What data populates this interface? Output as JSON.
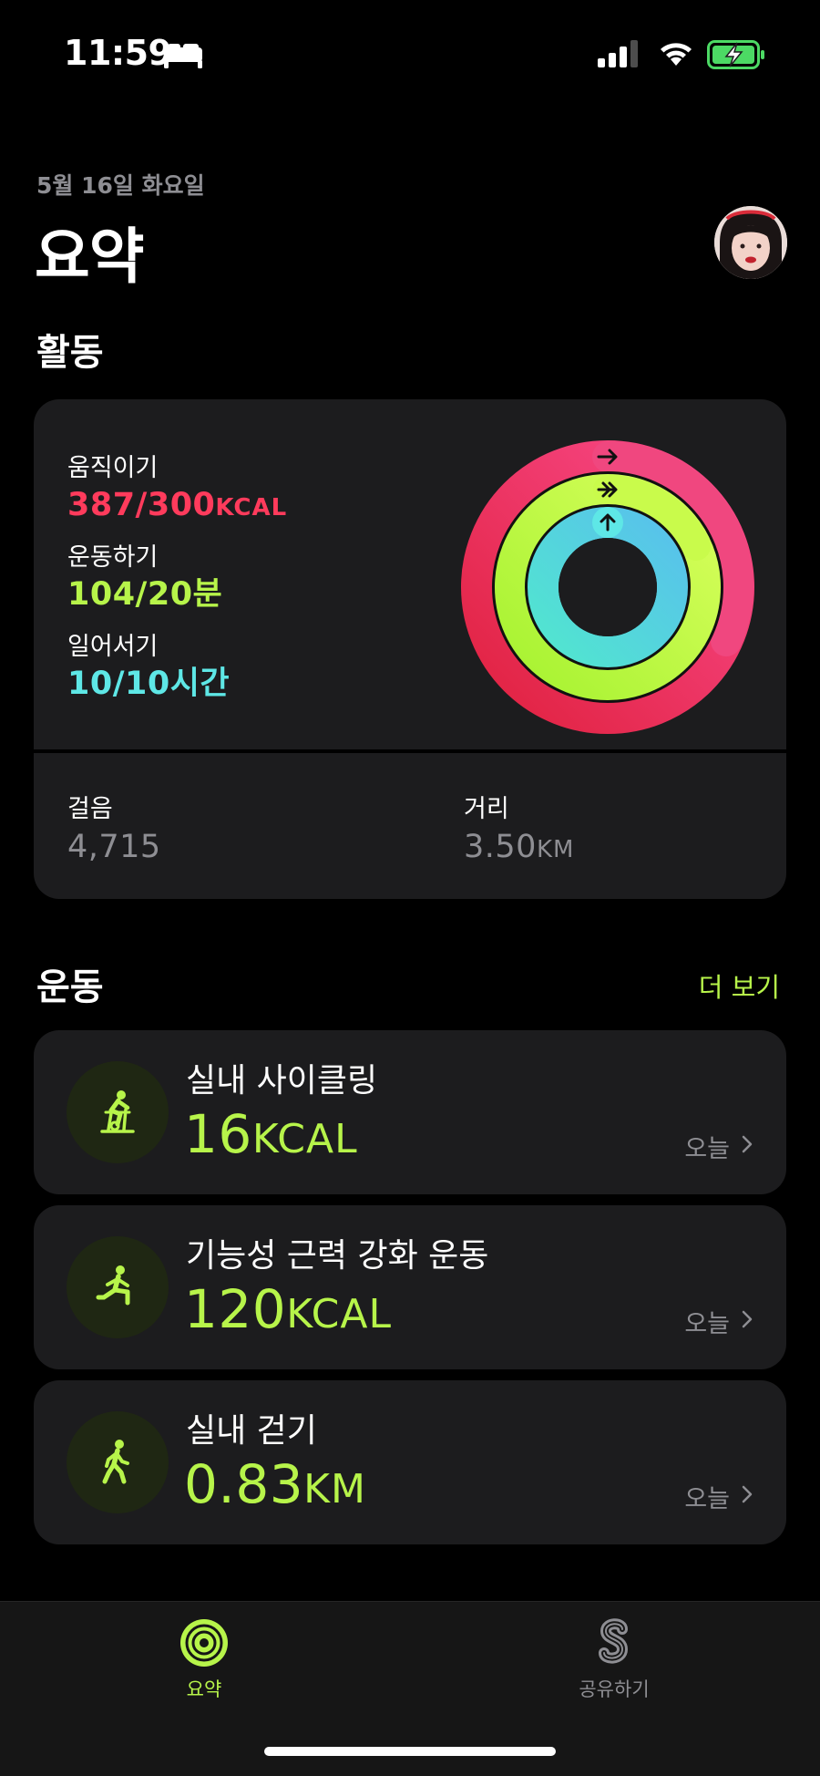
{
  "status_bar": {
    "time": "11:59",
    "icons": [
      "bed-icon",
      "signal-icon",
      "wifi-icon",
      "battery-charging-icon"
    ]
  },
  "header": {
    "date": "5월 16일 화요일",
    "title": "요약"
  },
  "activity": {
    "section_title": "활동",
    "move": {
      "label": "움직이기",
      "value": "387/300",
      "unit": "KCAL",
      "progress": 1.29,
      "color": "#ff3b5c"
    },
    "exercise": {
      "label": "운동하기",
      "value": "104/20분",
      "progress": 5.2,
      "color": "#b7f44a"
    },
    "stand": {
      "label": "일어서기",
      "value": "10/10시간",
      "progress": 1.0,
      "color": "#5ee7e6"
    },
    "steps": {
      "label": "걸음",
      "value": "4,715"
    },
    "distance": {
      "label": "거리",
      "value": "3.50",
      "unit": "KM"
    }
  },
  "workouts": {
    "section_title": "운동",
    "more_label": "더 보기",
    "items": [
      {
        "name": "실내 사이클링",
        "value": "16",
        "unit": "KCAL",
        "date": "오늘",
        "icon": "indoor-cycle-icon"
      },
      {
        "name": "기능성 근력 강화 운동",
        "value": "120",
        "unit": "KCAL",
        "date": "오늘",
        "icon": "strength-training-icon"
      },
      {
        "name": "실내 걷기",
        "value": "0.83",
        "unit": "KM",
        "date": "오늘",
        "icon": "walking-icon"
      }
    ]
  },
  "tab_bar": {
    "summary_label": "요약",
    "sharing_label": "공유하기",
    "active_color": "#b7f44a"
  }
}
